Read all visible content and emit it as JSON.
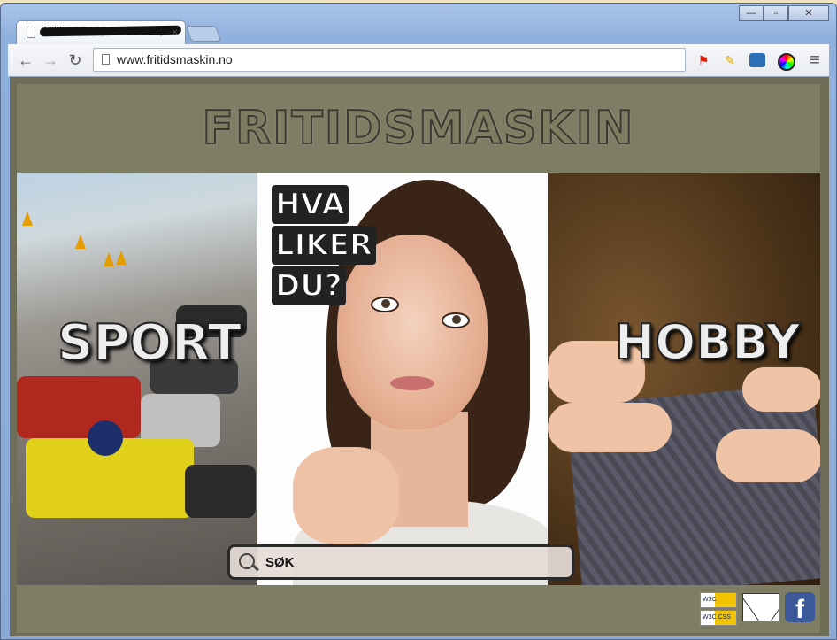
{
  "browser": {
    "tab_title": "fritidsmaskin (YOUR TITLE)",
    "tab_close": "×",
    "url": "www.fritidsmaskin.no",
    "window_buttons": {
      "minimize": "—",
      "restore": "▫",
      "close": "✕"
    },
    "nav": {
      "back": "←",
      "forward": "→",
      "reload": "↻",
      "menu": "≡"
    },
    "extensions": [
      "flag-icon",
      "pencil-icon",
      "screen-capture-icon",
      "color-wheel-icon"
    ]
  },
  "site": {
    "logo": "FRITIDSMASKIN",
    "panels": {
      "left_label": "SPORT",
      "middle_question": [
        "HVA",
        "LIKER",
        "DU?"
      ],
      "right_label": "HOBBY"
    },
    "search_label": "SØK",
    "footer": {
      "w3c_badges": [
        "W3C XHTML 1.0",
        "W3C CSS"
      ],
      "mail_icon": "mail-icon",
      "facebook_label": "f"
    }
  },
  "colors": {
    "site_background": "#7e7e64",
    "frame_blue": "#8fb0de",
    "facebook_blue": "#3b5998"
  }
}
